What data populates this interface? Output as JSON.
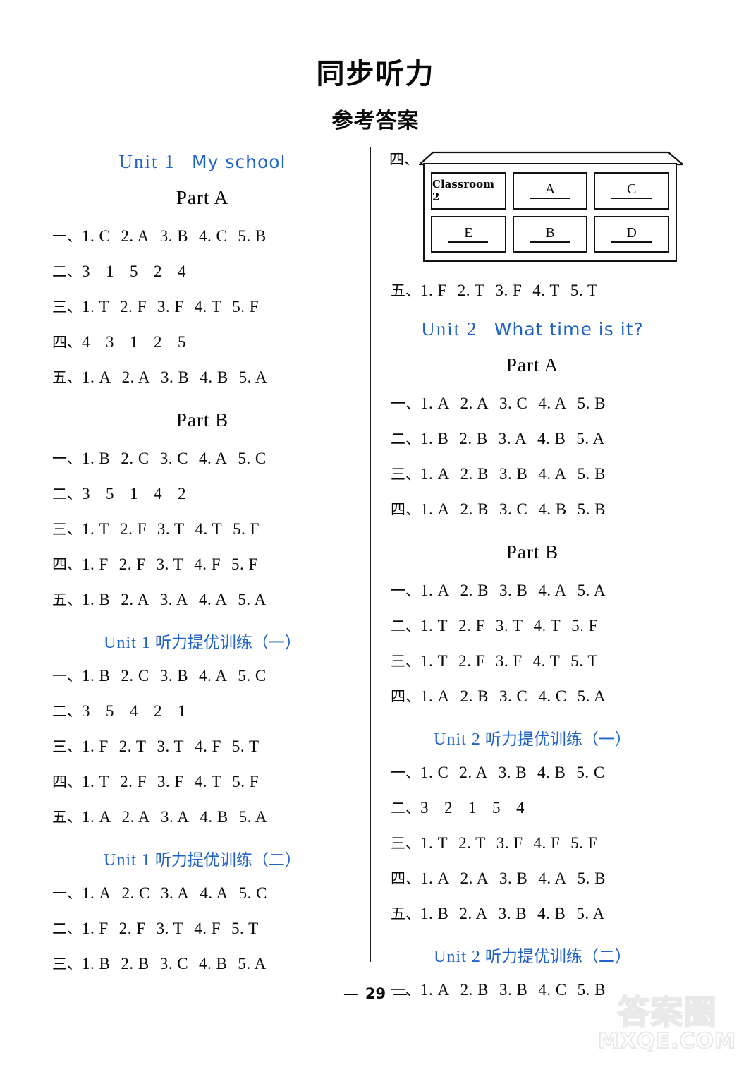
{
  "document": {
    "title": "同步听力",
    "subtitle": "参考答案",
    "page_number": "29",
    "footer_dash": "—"
  },
  "watermark": {
    "cn": "答案圈",
    "en": "MXQE.COM"
  },
  "left_column": {
    "unit_heading": {
      "en": "Unit 1",
      "cn": "My school"
    },
    "sections": [
      {
        "heading": "Part A",
        "rows": [
          {
            "idx": "一、",
            "items": [
              "1. C",
              "2. A",
              "3. B",
              "4. C",
              "5. B"
            ],
            "seq": false
          },
          {
            "idx": "二、",
            "items": [
              "3",
              "1",
              "5",
              "2",
              "4"
            ],
            "seq": true
          },
          {
            "idx": "三、",
            "items": [
              "1. T",
              "2. F",
              "3. F",
              "4. T",
              "5. F"
            ],
            "seq": false
          },
          {
            "idx": "四、",
            "items": [
              "4",
              "3",
              "1",
              "2",
              "5"
            ],
            "seq": true
          },
          {
            "idx": "五、",
            "items": [
              "1. A",
              "2. A",
              "3. B",
              "4. B",
              "5. A"
            ],
            "seq": false
          }
        ]
      },
      {
        "heading": "Part B",
        "rows": [
          {
            "idx": "一、",
            "items": [
              "1. B",
              "2. C",
              "3. C",
              "4. A",
              "5. C"
            ],
            "seq": false
          },
          {
            "idx": "二、",
            "items": [
              "3",
              "5",
              "1",
              "4",
              "2"
            ],
            "seq": true
          },
          {
            "idx": "三、",
            "items": [
              "1. T",
              "2. F",
              "3. T",
              "4. T",
              "5. F"
            ],
            "seq": false
          },
          {
            "idx": "四、",
            "items": [
              "1. F",
              "2. F",
              "3. T",
              "4. F",
              "5. F"
            ],
            "seq": false
          },
          {
            "idx": "五、",
            "items": [
              "1. B",
              "2. A",
              "3. A",
              "4. A",
              "5. A"
            ],
            "seq": false
          }
        ]
      },
      {
        "train_heading": {
          "en": "Unit 1",
          "cn": "听力提优训练（一）"
        },
        "rows": [
          {
            "idx": "一、",
            "items": [
              "1. B",
              "2. C",
              "3. B",
              "4. A",
              "5. C"
            ],
            "seq": false
          },
          {
            "idx": "二、",
            "items": [
              "3",
              "5",
              "4",
              "2",
              "1"
            ],
            "seq": true
          },
          {
            "idx": "三、",
            "items": [
              "1. F",
              "2. T",
              "3. T",
              "4. F",
              "5. T"
            ],
            "seq": false
          },
          {
            "idx": "四、",
            "items": [
              "1. T",
              "2. F",
              "3. F",
              "4. T",
              "5. F"
            ],
            "seq": false
          },
          {
            "idx": "五、",
            "items": [
              "1. A",
              "2. A",
              "3. A",
              "4. B",
              "5. A"
            ],
            "seq": false
          }
        ]
      },
      {
        "train_heading": {
          "en": "Unit 1",
          "cn": "听力提优训练（二）"
        },
        "rows": [
          {
            "idx": "一、",
            "items": [
              "1. A",
              "2. C",
              "3. A",
              "4. A",
              "5. C"
            ],
            "seq": false
          },
          {
            "idx": "二、",
            "items": [
              "1. F",
              "2. F",
              "3. T",
              "4. F",
              "5. T"
            ],
            "seq": false
          },
          {
            "idx": "三、",
            "items": [
              "1. B",
              "2. B",
              "3. C",
              "4. B",
              "5. A"
            ],
            "seq": false
          }
        ]
      }
    ]
  },
  "right_column": {
    "house": {
      "label": "四、",
      "rooms": [
        {
          "text": "Classroom 2",
          "given": true
        },
        {
          "text": "A",
          "given": false
        },
        {
          "text": "C",
          "given": false
        },
        {
          "text": "E",
          "given": false
        },
        {
          "text": "B",
          "given": false
        },
        {
          "text": "D",
          "given": false
        }
      ]
    },
    "after_house_rows": [
      {
        "idx": "五、",
        "items": [
          "1. F",
          "2. T",
          "3. F",
          "4. T",
          "5. T"
        ],
        "seq": false
      }
    ],
    "unit_heading": {
      "en": "Unit 2",
      "cn": "What time is it?"
    },
    "sections": [
      {
        "heading": "Part A",
        "rows": [
          {
            "idx": "一、",
            "items": [
              "1. A",
              "2. A",
              "3. C",
              "4. A",
              "5. B"
            ],
            "seq": false
          },
          {
            "idx": "二、",
            "items": [
              "1. B",
              "2. B",
              "3. A",
              "4. B",
              "5. A"
            ],
            "seq": false
          },
          {
            "idx": "三、",
            "items": [
              "1. A",
              "2. B",
              "3. B",
              "4. A",
              "5. B"
            ],
            "seq": false
          },
          {
            "idx": "四、",
            "items": [
              "1. A",
              "2. B",
              "3. C",
              "4. B",
              "5. B"
            ],
            "seq": false
          }
        ]
      },
      {
        "heading": "Part B",
        "rows": [
          {
            "idx": "一、",
            "items": [
              "1. A",
              "2. B",
              "3. B",
              "4. A",
              "5. A"
            ],
            "seq": false
          },
          {
            "idx": "二、",
            "items": [
              "1. T",
              "2. F",
              "3. T",
              "4. T",
              "5. F"
            ],
            "seq": false
          },
          {
            "idx": "三、",
            "items": [
              "1. T",
              "2. F",
              "3. F",
              "4. T",
              "5. T"
            ],
            "seq": false
          },
          {
            "idx": "四、",
            "items": [
              "1. A",
              "2. B",
              "3. C",
              "4. C",
              "5. A"
            ],
            "seq": false
          }
        ]
      },
      {
        "train_heading": {
          "en": "Unit 2",
          "cn": "听力提优训练（一）"
        },
        "rows": [
          {
            "idx": "一、",
            "items": [
              "1. C",
              "2. A",
              "3. B",
              "4. B",
              "5. C"
            ],
            "seq": false
          },
          {
            "idx": "二、",
            "items": [
              "3",
              "2",
              "1",
              "5",
              "4"
            ],
            "seq": true
          },
          {
            "idx": "三、",
            "items": [
              "1. T",
              "2. T",
              "3. F",
              "4. F",
              "5. F"
            ],
            "seq": false
          },
          {
            "idx": "四、",
            "items": [
              "1. A",
              "2. A",
              "3. B",
              "4. A",
              "5. B"
            ],
            "seq": false
          },
          {
            "idx": "五、",
            "items": [
              "1. B",
              "2. A",
              "3. B",
              "4. B",
              "5. A"
            ],
            "seq": false
          }
        ]
      },
      {
        "train_heading": {
          "en": "Unit 2",
          "cn": "听力提优训练（二）"
        },
        "rows": [
          {
            "idx": "一、",
            "items": [
              "1. A",
              "2. B",
              "3. B",
              "4. C",
              "5. B"
            ],
            "seq": false
          }
        ]
      }
    ]
  },
  "colors": {
    "heading_blue": "#1f63c8",
    "text_black": "#0a0a0a"
  }
}
